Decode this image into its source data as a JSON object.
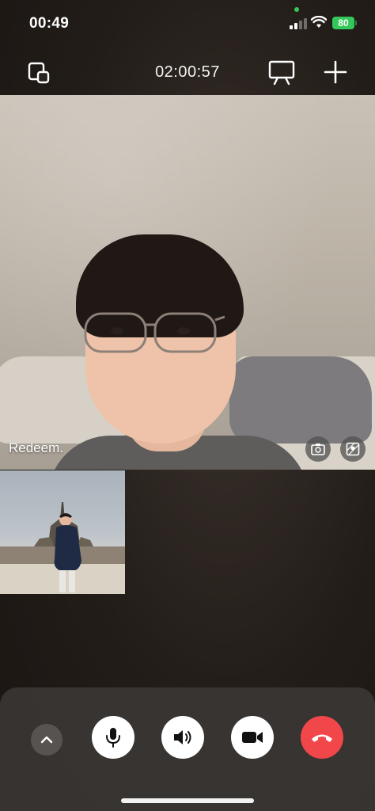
{
  "status_bar": {
    "time": "00:49",
    "battery": "80"
  },
  "top_bar": {
    "call_duration": "02:00:57",
    "left_icon": "picture-in-picture-icon",
    "screen_share_icon": "screen-share-icon",
    "add_icon": "plus-icon"
  },
  "main_video": {
    "caller_name": "Redeem.",
    "flip_camera_icon": "camera-rotate-icon",
    "portrait_icon": "portrait-mode-icon"
  },
  "controls": {
    "expand_icon": "chevron-up-icon",
    "mic_icon": "microphone-icon",
    "speaker_icon": "speaker-icon",
    "video_icon": "video-camera-icon",
    "end_call_icon": "phone-hangup-icon",
    "end_call_color": "#f2474a"
  }
}
